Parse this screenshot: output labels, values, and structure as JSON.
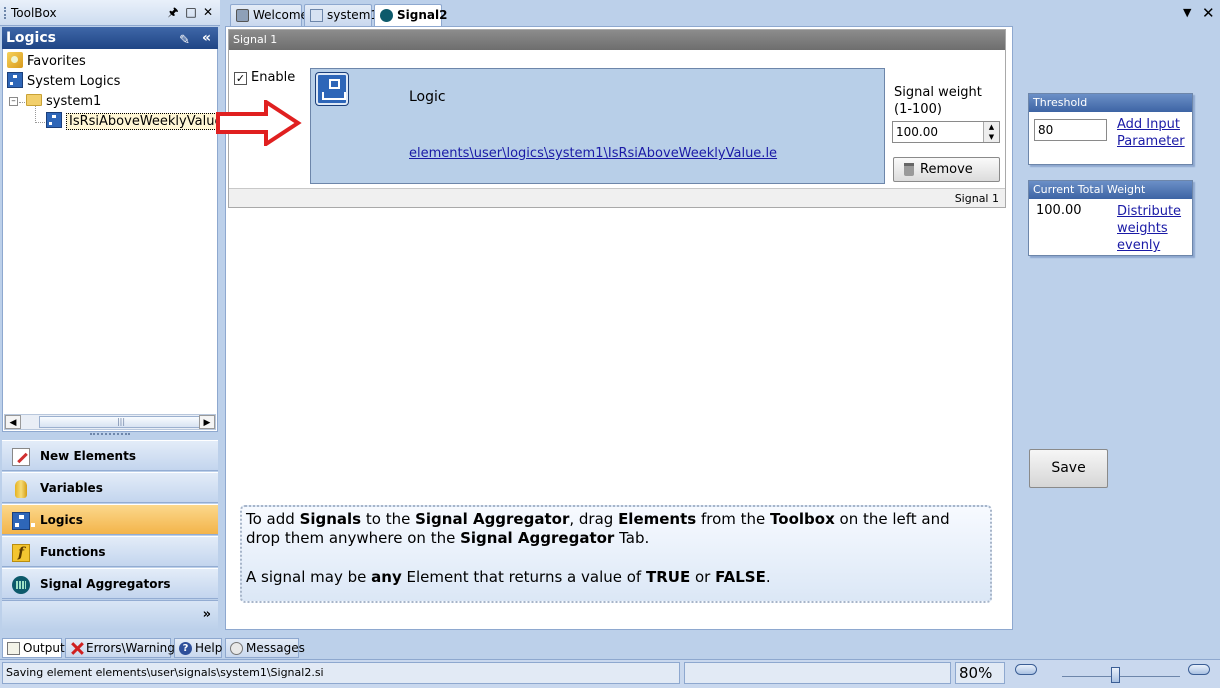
{
  "toolbox": {
    "title": "ToolBox",
    "pin_icon": "pin-icon",
    "float_icon": "float-window-icon",
    "close_icon": "close-icon",
    "section_title": "Logics",
    "tree": [
      {
        "label": "Favorites",
        "icon": "favorites-icon"
      },
      {
        "label": "System Logics",
        "icon": "logic-icon"
      },
      {
        "label": "system1",
        "icon": "folder-icon",
        "expander": "⊟"
      },
      {
        "label": "IsRsiAboveWeeklyValue",
        "icon": "logic-icon",
        "selected": true
      }
    ],
    "scroll_grip": "|||",
    "nav": [
      {
        "label": "New Elements",
        "icon": "new-elements-icon"
      },
      {
        "label": "Variables",
        "icon": "variables-icon"
      },
      {
        "label": "Logics",
        "icon": "logics-icon",
        "active": true
      },
      {
        "label": "Functions",
        "icon": "functions-icon",
        "glyph": "f"
      },
      {
        "label": "Signal Aggregators",
        "icon": "signal-aggregators-icon"
      }
    ],
    "more": "»"
  },
  "tabs": [
    {
      "label": "Welcome",
      "icon": "welcome-icon"
    },
    {
      "label": "system1",
      "icon": "system-icon"
    },
    {
      "label": "Signal2",
      "icon": "signal-icon",
      "active": true
    }
  ],
  "signal": {
    "header": "Signal 1",
    "enable_label": "Enable",
    "enable_checked": true,
    "logic_label": "Logic",
    "logic_path": "elements\\user\\logics\\system1\\IsRsiAboveWeeklyValue.le",
    "weight_label_line1": "Signal weight",
    "weight_label_line2": "(1-100)",
    "weight_value": "100.00",
    "remove_label": "Remove",
    "footer": "Signal 1"
  },
  "info": {
    "p1_a": "To add ",
    "p1_b": "Signals",
    "p1_c": " to the ",
    "p1_d": "Signal Aggregator",
    "p1_e": ", drag ",
    "p1_f": "Elements",
    "p1_g": " from the ",
    "p1_h": "Toolbox",
    "p1_i": " on the left and drop them anywhere on the ",
    "p1_j": "Signal Aggregator",
    "p1_k": " Tab.",
    "p2_a": "A signal may be ",
    "p2_b": "any",
    "p2_c": " Element that returns a value of ",
    "p2_d": "TRUE",
    "p2_e": " or ",
    "p2_f": "FALSE",
    "p2_g": "."
  },
  "threshold": {
    "title": "Threshold",
    "value": "80",
    "link_line1": "Add Input ",
    "link_line2": "Parameter"
  },
  "total_weight": {
    "title": "Current Total Weight",
    "value": "100.00",
    "link_line1": "Distribute ",
    "link_line2": "weights ",
    "link_line3": "evenly"
  },
  "save_label": "Save",
  "bottom_tabs": [
    {
      "label": "Output",
      "icon": "output-icon",
      "active": true
    },
    {
      "label": "Errors\\Warnings",
      "icon": "errors-icon"
    },
    {
      "label": "Help",
      "icon": "help-icon",
      "glyph": "?"
    },
    {
      "label": "Messages",
      "icon": "messages-icon"
    }
  ],
  "status": {
    "text": "Saving element elements\\user\\signals\\system1\\Signal2.si",
    "zoom": "80%",
    "zoom_level": 0.45
  },
  "colors": {
    "accent_active": "#f3b44a",
    "header_blue": "#1f4585",
    "link": "#1a1aa6",
    "arrow": "#e02020"
  }
}
